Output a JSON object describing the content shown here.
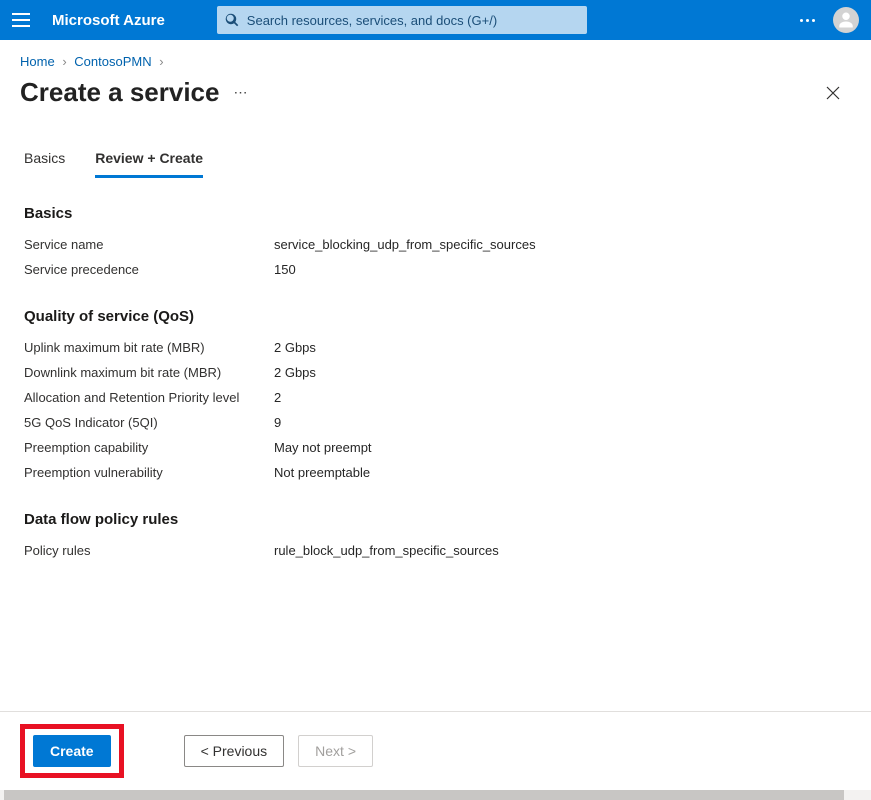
{
  "header": {
    "brand": "Microsoft Azure",
    "search_placeholder": "Search resources, services, and docs (G+/)"
  },
  "breadcrumb": {
    "items": [
      "Home",
      "ContosoPMN"
    ]
  },
  "page": {
    "title": "Create a service"
  },
  "tabs": [
    {
      "label": "Basics"
    },
    {
      "label": "Review + Create"
    }
  ],
  "sections": {
    "basics": {
      "heading": "Basics",
      "rows": [
        {
          "label": "Service name",
          "value": "service_blocking_udp_from_specific_sources"
        },
        {
          "label": "Service precedence",
          "value": "150"
        }
      ]
    },
    "qos": {
      "heading": "Quality of service (QoS)",
      "rows": [
        {
          "label": "Uplink maximum bit rate (MBR)",
          "value": "2 Gbps"
        },
        {
          "label": "Downlink maximum bit rate (MBR)",
          "value": "2 Gbps"
        },
        {
          "label": "Allocation and Retention Priority level",
          "value": "2"
        },
        {
          "label": "5G QoS Indicator (5QI)",
          "value": "9"
        },
        {
          "label": "Preemption capability",
          "value": "May not preempt"
        },
        {
          "label": "Preemption vulnerability",
          "value": "Not preemptable"
        }
      ]
    },
    "dataflow": {
      "heading": "Data flow policy rules",
      "rows": [
        {
          "label": "Policy rules",
          "value": "rule_block_udp_from_specific_sources"
        }
      ]
    }
  },
  "footer": {
    "create": "Create",
    "previous": "< Previous",
    "next": "Next >"
  }
}
